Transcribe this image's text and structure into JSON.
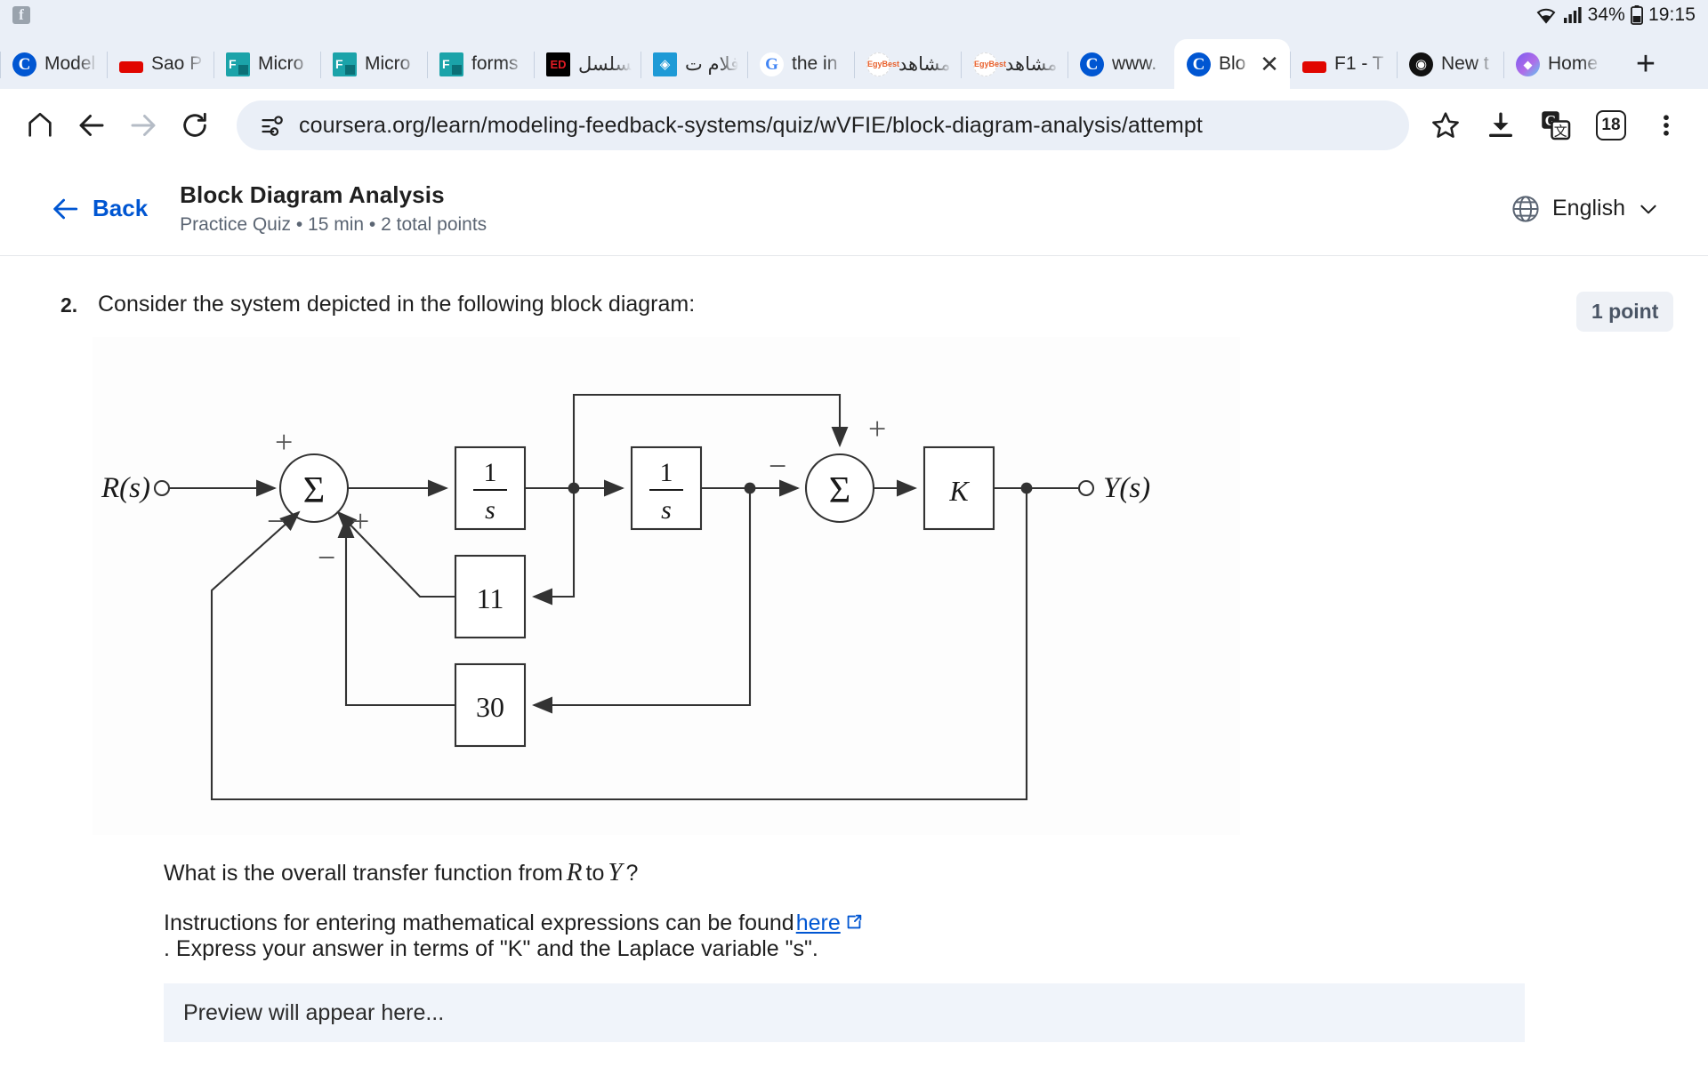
{
  "status_bar": {
    "left_icon": "facebook-icon",
    "wifi_icon": "wifi-icon",
    "signal_icon": "cellular-signal-icon",
    "battery_percent": "34%",
    "battery_icon": "battery-icon",
    "clock": "19:15"
  },
  "tabs": [
    {
      "title": "Model",
      "favicon": "coursera-icon",
      "favicon_glyph": "C",
      "active": false
    },
    {
      "title": "Sao P",
      "favicon": "f1-icon",
      "favicon_glyph": "",
      "active": false
    },
    {
      "title": "Micro",
      "favicon": "microsoft-forms-icon",
      "favicon_glyph": "F",
      "active": false
    },
    {
      "title": "Micro",
      "favicon": "microsoft-forms-icon",
      "favicon_glyph": "F",
      "active": false
    },
    {
      "title": "forms",
      "favicon": "microsoft-forms-icon",
      "favicon_glyph": "F",
      "active": false
    },
    {
      "title": "مسلسل",
      "favicon": "egybest-icon",
      "favicon_glyph": "ED",
      "active": false
    },
    {
      "title": "أفلام ت",
      "favicon": "aljazeera-icon",
      "favicon_glyph": "◈",
      "active": false
    },
    {
      "title": "the in",
      "favicon": "google-icon",
      "favicon_glyph": "G",
      "active": false
    },
    {
      "title": "مشاهد",
      "favicon": "egybest-icon",
      "favicon_glyph": "EgyBest",
      "active": false
    },
    {
      "title": "مشاهد",
      "favicon": "egybest-icon",
      "favicon_glyph": "EgyBest",
      "active": false
    },
    {
      "title": "www.",
      "favicon": "coursera-icon",
      "favicon_glyph": "C",
      "active": false
    },
    {
      "title": "Blo",
      "favicon": "coursera-icon",
      "favicon_glyph": "C",
      "active": true
    },
    {
      "title": "F1 - T",
      "favicon": "f1-icon",
      "favicon_glyph": "",
      "active": false
    },
    {
      "title": "New t",
      "favicon": "brave-icon",
      "favicon_glyph": "◉",
      "active": false
    },
    {
      "title": "Home",
      "favicon": "home-app-icon",
      "favicon_glyph": "◆",
      "active": false
    }
  ],
  "tab_close_glyph": "✕",
  "new_tab_glyph": "+",
  "omnibox": {
    "home_icon": "home-icon",
    "back_icon": "back-arrow-icon",
    "forward_icon": "forward-arrow-icon",
    "reload_icon": "reload-icon",
    "site_info_icon": "page-info-icon",
    "url": "coursera.org/learn/modeling-feedback-systems/quiz/wVFIE/block-diagram-analysis/attempt",
    "bookmark_icon": "star-icon",
    "download_icon": "download-icon",
    "translate_icon": "google-translate-icon",
    "tab_count": "18",
    "menu_icon": "three-dot-menu-icon"
  },
  "quiz_header": {
    "back_label": "Back",
    "back_icon": "arrow-left-icon",
    "title": "Block Diagram Analysis",
    "subtitle": "Practice Quiz • 15 min • 2 total points",
    "language_label": "English",
    "globe_icon": "globe-icon",
    "chevron_icon": "chevron-down-icon"
  },
  "question": {
    "number": "2.",
    "prompt": "Consider the system depicted in the following block diagram:",
    "points_badge": "1 point",
    "transfer_question_pre": "What is the overall transfer function from",
    "transfer_var_from": "R",
    "transfer_mid": "to",
    "transfer_var_to": "Y",
    "transfer_question_post": "?",
    "instructions_pre": "Instructions for entering mathematical expressions can be found",
    "instructions_link": "here",
    "external_link_icon": "external-link-icon",
    "instructions_post": ".  Express your answer in terms of \"K\" and the Laplace variable \"s\".",
    "preview_placeholder": "Preview will appear here..."
  },
  "block_diagram": {
    "input_label": "R(s)",
    "output_label": "Y(s)",
    "sum_glyph": "Σ",
    "blocks": [
      {
        "name": "integrator-1",
        "label_num": "1",
        "label_den": "s"
      },
      {
        "name": "integrator-2",
        "label_num": "1",
        "label_den": "s"
      },
      {
        "name": "gain-k",
        "label": "K"
      },
      {
        "name": "gain-11",
        "label": "11"
      },
      {
        "name": "gain-30",
        "label": "30"
      }
    ],
    "summer_1_signs": [
      "+",
      "+",
      "−",
      "−"
    ],
    "summer_2_signs": [
      "+",
      "−"
    ]
  }
}
